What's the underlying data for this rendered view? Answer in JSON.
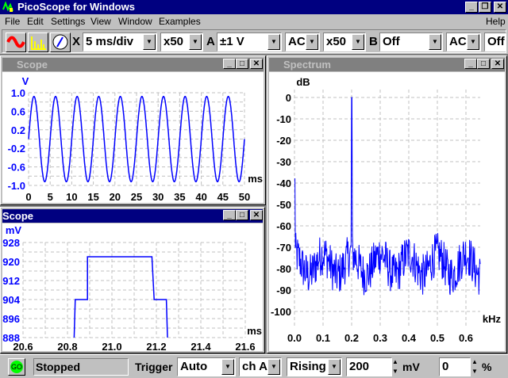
{
  "app": {
    "title": "PicoScope for Windows"
  },
  "menu": [
    "File",
    "Edit",
    "Settings",
    "View",
    "Window",
    "Examples",
    "Help"
  ],
  "toolbar": {
    "x_label": "X",
    "timebase": "5 ms/div",
    "x_mult": "x50",
    "a_label": "A",
    "a_range": "±1 V",
    "a_coupling": "AC",
    "a_mult": "x50",
    "b_label": "B",
    "b_range": "Off",
    "b_coupling": "AC",
    "b_extra": "Off"
  },
  "status": {
    "go": "GO",
    "state": "Stopped",
    "trigger_label": "Trigger",
    "trigger_mode": "Auto",
    "trigger_channel": "ch A",
    "trigger_edge": "Rising",
    "threshold": "200",
    "threshold_unit": "mV",
    "delay": "0",
    "delay_unit": "%"
  },
  "colors": {
    "trace": "#0000ff",
    "axis_text": "#0000ff",
    "grid": "#c0c0c0"
  },
  "chart_data": [
    {
      "window_title": "Scope",
      "type": "line",
      "ylabel": "V",
      "xlabel": "ms",
      "xlim": [
        0,
        50
      ],
      "ylim": [
        -1,
        1
      ],
      "yticks": [
        "1.0",
        "0.6",
        "0.2",
        "-0.2",
        "-0.6",
        "-1.0"
      ],
      "xticks": [
        "0",
        "5",
        "10",
        "15",
        "20",
        "25",
        "30",
        "35",
        "40",
        "45",
        "50"
      ],
      "signal": {
        "shape": "sine",
        "frequency_hz": 200,
        "amplitude_v": 0.92
      },
      "grid": true
    },
    {
      "window_title": "Scope",
      "type": "line",
      "ylabel": "mV",
      "xlabel": "ms",
      "xlim": [
        20.6,
        21.6
      ],
      "ylim": [
        888,
        928
      ],
      "yticks": [
        "928",
        "920",
        "912",
        "904",
        "896",
        "888"
      ],
      "xticks": [
        "20.6",
        "20.8",
        "21.0",
        "21.2",
        "21.4",
        "21.6"
      ],
      "x": [
        20.83,
        20.835,
        20.835,
        20.89,
        20.89,
        21.18,
        21.19,
        21.19,
        21.245,
        21.25
      ],
      "y": [
        888,
        904,
        904,
        904,
        922,
        922,
        904,
        904,
        904,
        888
      ],
      "grid": true
    },
    {
      "window_title": "Spectrum",
      "type": "line",
      "ylabel": "dB",
      "xlabel": "kHz",
      "xlim": [
        0,
        0.65
      ],
      "ylim": [
        -100,
        0
      ],
      "yticks": [
        "0",
        "-10",
        "-20",
        "-30",
        "-40",
        "-50",
        "-60",
        "-70",
        "-80",
        "-90",
        "-100"
      ],
      "xticks": [
        "0.0",
        "0.1",
        "0.2",
        "0.3",
        "0.4",
        "0.5",
        "0.6"
      ],
      "peaks": [
        {
          "x": 0.0,
          "y": -38
        },
        {
          "x": 0.2,
          "y": 0
        }
      ],
      "noise_floor_db": -78,
      "noise_spread_db": 10,
      "grid": true
    }
  ]
}
